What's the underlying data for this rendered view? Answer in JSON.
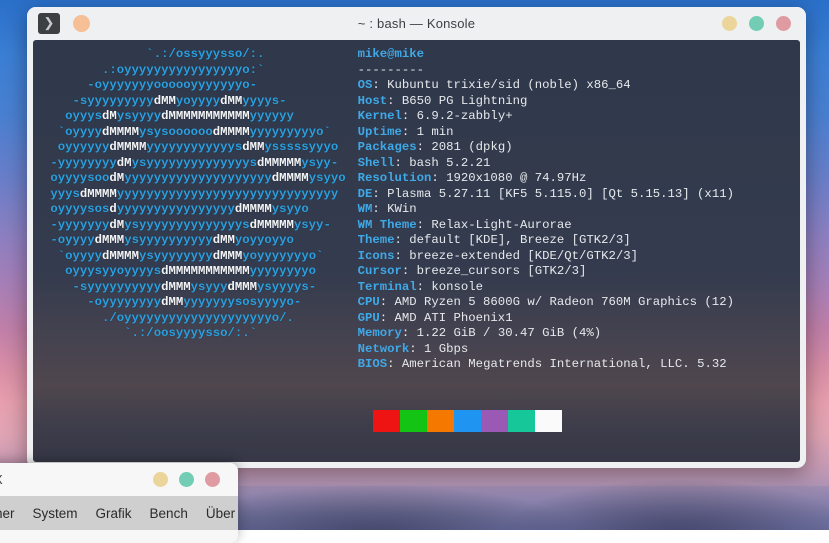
{
  "window": {
    "title": "~ : bash — Konsole",
    "icon_name": "konsole-icon",
    "icon_glyph": "❯",
    "controls": {
      "minimize": "",
      "maximize": "",
      "close": ""
    }
  },
  "terminal": {
    "ascii_art": [
      "              `.:/ossyyysso/:.",
      "        .:oyyyyyyyyyyyyyyyyo:`",
      "      -oyyyyyyyoooooyyyyyyyo-",
      "    -syyyyyyyyyd|MMy|oyyyydMMyyyys-",
      "   oyyysdMysyyyydMMMMMMMMMMMyyyyyy",
      "  `oyyyydMMMMysysoooooodMMMMyyyyyyyyyo`",
      "  oyyyyyydMMMMyyyyyyyyyyyysdMMysssssyyyo",
      " -yyyyyyyydMysyyyyyyyyyyyyyysdMMMMMysyy-",
      " oyyyysoodMyyyyyyyyyyyyyyyyyyyydMMMMysyyo",
      " yyysdMMMMyyyyyyyyyyyyyyyyyyyyyyyyyyyyyy",
      " oyyyysosdyyyyyyyyyyyyyyyydMMMMysyyo",
      " -yyyyyyydMysyyyyyyyyyyyyyysdMMMMMysyy-",
      " -oyyyydMMMysyyyyyyyyyydMMyoyyoyyo",
      "  `oyyyydMMMMysyyyyyyyydMMMyoyyyyyyyo`",
      "   oyyysyyoyyyysdMMMMMMMMMMMyyyyyyyyo",
      "    -syyyyyyyyyydMMMysyyydMMMysyyyys-",
      "      -oyyyyyyyydMMyyyyyyysosyyyyo-",
      "        ./oyyyyyyyyyyyyyyyyyyyyo/.",
      "           `.:/oosyyyysso/:.`"
    ],
    "user_host": "mike@mike",
    "divider": "---------",
    "info": [
      {
        "key": "OS",
        "value": "Kubuntu trixie/sid (noble) x86_64"
      },
      {
        "key": "Host",
        "value": "B650 PG Lightning"
      },
      {
        "key": "Kernel",
        "value": "6.9.2-zabbly+"
      },
      {
        "key": "Uptime",
        "value": "1 min"
      },
      {
        "key": "Packages",
        "value": "2081 (dpkg)"
      },
      {
        "key": "Shell",
        "value": "bash 5.2.21"
      },
      {
        "key": "Resolution",
        "value": "1920x1080 @ 74.97Hz"
      },
      {
        "key": "DE",
        "value": "Plasma 5.27.11 [KF5 5.115.0] [Qt 5.15.13] (x11)"
      },
      {
        "key": "WM",
        "value": "KWin"
      },
      {
        "key": "WM Theme",
        "value": "Relax-Light-Aurorae"
      },
      {
        "key": "Theme",
        "value": "default [KDE], Breeze [GTK2/3]"
      },
      {
        "key": "Icons",
        "value": "breeze-extended [KDE/Qt/GTK2/3]"
      },
      {
        "key": "Cursor",
        "value": "breeze_cursors [GTK2/3]"
      },
      {
        "key": "Terminal",
        "value": "konsole"
      },
      {
        "key": "CPU",
        "value": "AMD Ryzen 5 8600G w/ Radeon 760M Graphics (12)"
      },
      {
        "key": "GPU",
        "value": "AMD ATI Phoenix1"
      },
      {
        "key": "Memory",
        "value": "1.22 GiB / 30.47 GiB (4%)"
      },
      {
        "key": "Network",
        "value": "1 Gbps"
      },
      {
        "key": "BIOS",
        "value": "American Megatrends International, LLC. 5.32"
      }
    ],
    "palette": {
      "row_bright": [
        "transparent",
        "#ef1414",
        "#14c414",
        "#f57900",
        "#1f94f0",
        "#9b59b6",
        "#16c79a",
        "#fafafa"
      ],
      "row_normal": [
        "#8a979b",
        "#c0392b",
        "#1fdd95",
        "#ffc04d",
        "#3fa9f0",
        "#8e44ad",
        "#17a589",
        "#ffffff"
      ]
    },
    "colors": {
      "accent": "#3fa9e8",
      "logo": "#2aa0e0",
      "text": "#e6e9ec",
      "background": "#212a3e"
    }
  },
  "secondary_window": {
    "title": "X",
    "tabs": [
      "her",
      "System",
      "Grafik",
      "Bench",
      "Über"
    ]
  }
}
